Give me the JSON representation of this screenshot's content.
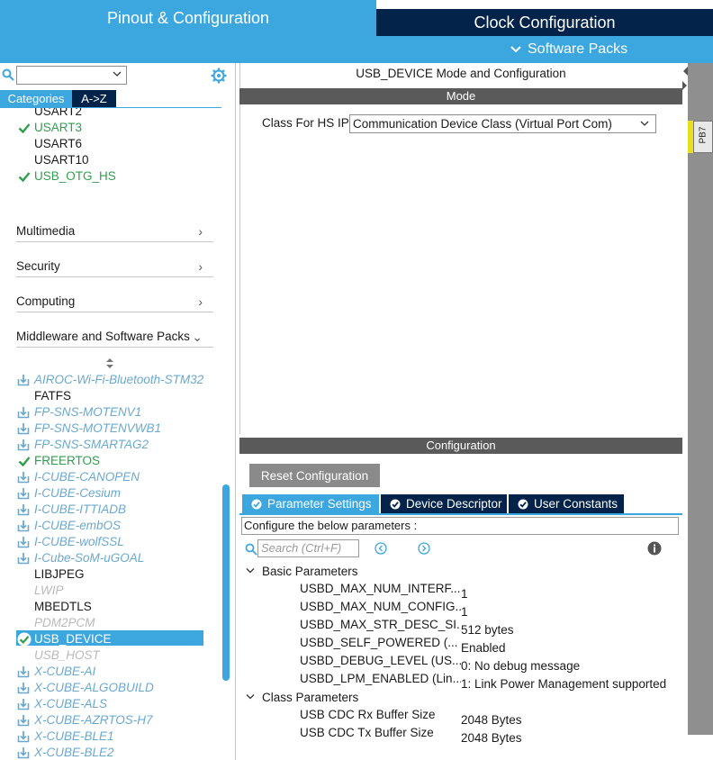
{
  "header": {
    "tab_pinout": "Pinout & Configuration",
    "tab_clock": "Clock Configuration",
    "software_packs": "Software Packs"
  },
  "sidebar": {
    "tab_categories": "Categories",
    "tab_az": "A->Z",
    "connectivity_items": [
      {
        "label": "USART2",
        "state": "plain"
      },
      {
        "label": "USART3",
        "state": "enabled"
      },
      {
        "label": "USART6",
        "state": "plain"
      },
      {
        "label": "USART10",
        "state": "plain"
      },
      {
        "label": "USB_OTG_HS",
        "state": "enabled"
      }
    ],
    "categories": [
      {
        "label": "Multimedia",
        "chevron": "›"
      },
      {
        "label": "Security",
        "chevron": "›"
      },
      {
        "label": "Computing",
        "chevron": "›"
      },
      {
        "label": "Middleware and Software Packs",
        "chevron": "⌄"
      }
    ],
    "middleware_items": [
      {
        "label": "AIROC-Wi-Fi-Bluetooth-STM32",
        "state": "pack"
      },
      {
        "label": "FATFS",
        "state": "plain"
      },
      {
        "label": "FP-SNS-MOTENV1",
        "state": "pack"
      },
      {
        "label": "FP-SNS-MOTENVWB1",
        "state": "pack"
      },
      {
        "label": "FP-SNS-SMARTAG2",
        "state": "pack"
      },
      {
        "label": "FREERTOS",
        "state": "enabled"
      },
      {
        "label": "I-CUBE-CANOPEN",
        "state": "pack"
      },
      {
        "label": "I-CUBE-Cesium",
        "state": "pack"
      },
      {
        "label": "I-CUBE-ITTIADB",
        "state": "pack"
      },
      {
        "label": "I-CUBE-embOS",
        "state": "pack"
      },
      {
        "label": "I-CUBE-wolfSSL",
        "state": "pack"
      },
      {
        "label": "I-Cube-SoM-uGOAL",
        "state": "pack"
      },
      {
        "label": "LIBJPEG",
        "state": "plain"
      },
      {
        "label": "LWIP",
        "state": "disabled"
      },
      {
        "label": "MBEDTLS",
        "state": "plain"
      },
      {
        "label": "PDM2PCM",
        "state": "disabled"
      },
      {
        "label": "USB_DEVICE",
        "state": "selected"
      },
      {
        "label": "USB_HOST",
        "state": "disabled"
      },
      {
        "label": "X-CUBE-AI",
        "state": "pack"
      },
      {
        "label": "X-CUBE-ALGOBUILD",
        "state": "pack"
      },
      {
        "label": "X-CUBE-ALS",
        "state": "pack"
      },
      {
        "label": "X-CUBE-AZRTOS-H7",
        "state": "pack"
      },
      {
        "label": "X-CUBE-BLE1",
        "state": "pack"
      },
      {
        "label": "X-CUBE-BLE2",
        "state": "pack"
      }
    ]
  },
  "mode_panel": {
    "title": "USB_DEVICE Mode and Configuration",
    "mode_bar": "Mode",
    "class_label": "Class For HS IP",
    "class_value": "Communication Device Class (Virtual Port Com)"
  },
  "config_panel": {
    "bar": "Configuration",
    "reset_button": "Reset Configuration",
    "tabs": [
      "Parameter Settings",
      "Device Descriptor",
      "User Constants"
    ],
    "hint": "Configure the below parameters :",
    "search_placeholder": "Search (Ctrl+F)",
    "groups": [
      {
        "label": "Basic Parameters",
        "params": [
          {
            "name": "USBD_MAX_NUM_INTERF...",
            "value": "1"
          },
          {
            "name": "USBD_MAX_NUM_CONFIG...",
            "value": "1"
          },
          {
            "name": "USBD_MAX_STR_DESC_SI...",
            "value": "512 bytes"
          },
          {
            "name": "USBD_SELF_POWERED (...",
            "value": "Enabled"
          },
          {
            "name": "USBD_DEBUG_LEVEL (US...",
            "value": "0: No debug message"
          },
          {
            "name": "USBD_LPM_ENABLED (Lin...",
            "value": "1: Link Power Management supported"
          }
        ]
      },
      {
        "label": "Class Parameters",
        "params": [
          {
            "name": "USB CDC Rx Buffer Size",
            "value": "2048 Bytes"
          },
          {
            "name": "USB CDC Tx Buffer Size",
            "value": "2048 Bytes"
          }
        ]
      }
    ]
  },
  "pinout": {
    "pin_label": "PB7"
  },
  "colors": {
    "accent": "#3ca7df",
    "navy": "#03234b",
    "enabled_green": "#2f9e4d",
    "pin_yellow": "#e8e01f"
  }
}
